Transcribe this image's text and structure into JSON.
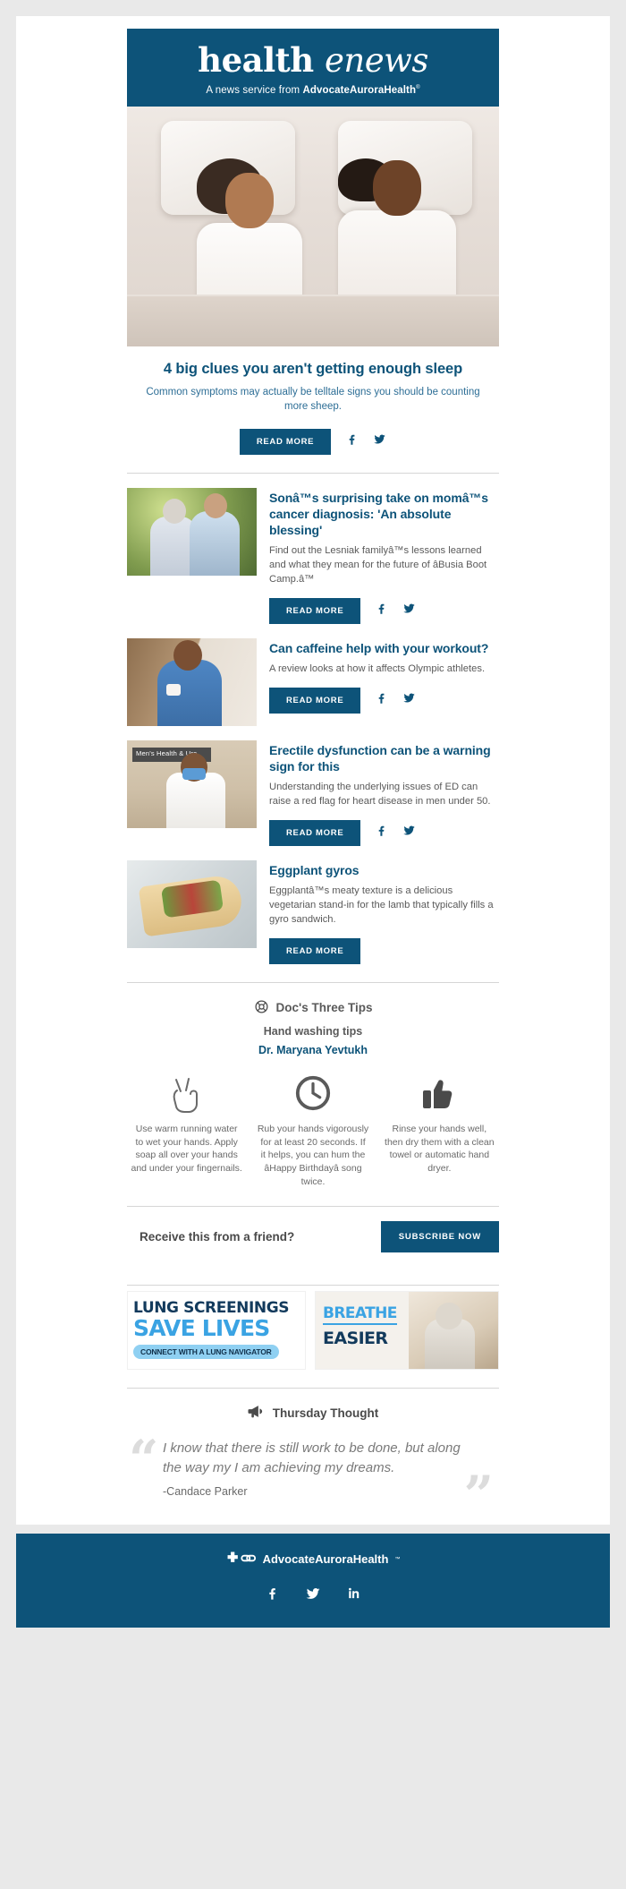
{
  "masthead": {
    "title_1": "health ",
    "title_2": "enews",
    "subtitle_pre": "A news service from ",
    "brand": "AdvocateAuroraHealth",
    "trademark": "®"
  },
  "featured": {
    "title": "4 big clues you aren't getting enough sleep",
    "description": "Common symptoms may actually be telltale signs you should be counting more sheep.",
    "cta": "READ MORE",
    "facebook_icon": "facebook-icon",
    "twitter_icon": "twitter-icon"
  },
  "articles": [
    {
      "title": "Sonâ™s surprising take on momâ™s cancer diagnosis: 'An absolute blessing'",
      "description": "Find out the Lesniak familyâ™s lessons learned and what they mean for the future of âBusia Boot Camp.â™",
      "cta": "READ MORE",
      "thumb": "couple-outdoors-photo",
      "has_social": true
    },
    {
      "title": "Can caffeine help with your workout?",
      "description": "A review looks at how it affects Olympic athletes.",
      "cta": "READ MORE",
      "thumb": "woman-drinking-coffee-photo",
      "has_social": true
    },
    {
      "title": "Erectile dysfunction can be a warning sign for this",
      "description": "Understanding the underlying issues of ED can raise a red flag for heart disease in men under 50.",
      "cta": "READ MORE",
      "thumb": "doctor-mens-health-photo",
      "thumb_sign": "Men's Health & Uro",
      "has_social": true
    },
    {
      "title": "Eggplant gyros",
      "description": "Eggplantâ™s meaty texture is a delicious vegetarian stand-in for the lamb that typically fills a gyro sandwich.",
      "cta": "READ MORE",
      "thumb": "eggplant-gyro-photo",
      "has_social": false
    }
  ],
  "tips_section": {
    "heading": "Doc's Three Tips",
    "heading_icon": "lifebuoy-icon",
    "subheading": "Hand washing tips",
    "author": "Dr. Maryana Yevtukh",
    "tips": [
      {
        "icon": "peace-hand-icon",
        "text": "Use warm running water to wet your hands. Apply soap all over your hands and under your fingernails."
      },
      {
        "icon": "clock-icon",
        "text": "Rub your hands vigorously for at least 20 seconds. If it helps, you can hum the âHappy Birthdayâ song twice."
      },
      {
        "icon": "thumbs-up-icon",
        "text": "Rinse your hands well, then dry them with a clean towel or automatic hand dryer."
      }
    ]
  },
  "subscribe": {
    "text": "Receive this from a friend?",
    "button": "SUBSCRIBE NOW"
  },
  "ads": [
    {
      "line1": "LUNG SCREENINGS",
      "line2": "SAVE LIVES",
      "pill": "CONNECT WITH A LUNG NAVIGATOR"
    },
    {
      "line1": "BREATHE",
      "line2": "EASIER",
      "image": "senior-woman-photo"
    }
  ],
  "thought": {
    "heading": "Thursday Thought",
    "heading_icon": "megaphone-icon",
    "quote": "I know that there is still work to be done, but along the way my I am achieving my dreams.",
    "attribution": "-Candace Parker",
    "open_quote": "“",
    "close_quote": "”"
  },
  "footer": {
    "brand": "AdvocateAuroraHealth",
    "trademark": "™",
    "logo_icon": "advocate-aurora-cross-link-logo",
    "social": [
      "facebook-icon",
      "twitter-icon",
      "linkedin-icon"
    ]
  },
  "colors": {
    "brand_blue": "#0d5379",
    "accent_light_blue": "#3aa3e3",
    "page_bg": "#e9e9e9"
  }
}
